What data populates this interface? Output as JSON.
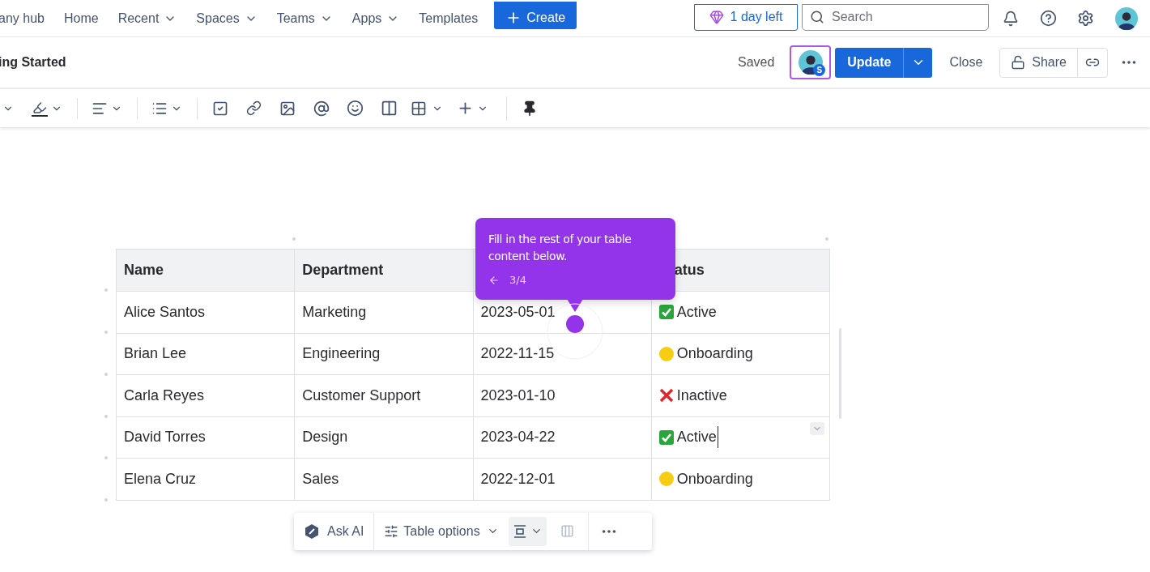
{
  "nav": {
    "items": [
      {
        "label": "any hub",
        "dropdown": false
      },
      {
        "label": "Home",
        "dropdown": false
      },
      {
        "label": "Recent",
        "dropdown": true
      },
      {
        "label": "Spaces",
        "dropdown": true
      },
      {
        "label": "Teams",
        "dropdown": true
      },
      {
        "label": "Apps",
        "dropdown": true
      },
      {
        "label": "Templates",
        "dropdown": false
      }
    ],
    "create": "Create",
    "trial": "1 day left",
    "search": {
      "placeholder": "Search"
    }
  },
  "page": {
    "title": "ing Started",
    "saved": "Saved",
    "collaborator_badge": "S",
    "update": "Update",
    "close": "Close",
    "share": "Share"
  },
  "tooltip": {
    "text": "Fill in the rest of your table content below.",
    "step": "3/4"
  },
  "table": {
    "columns": [
      {
        "label": "Name"
      },
      {
        "label": "Department"
      },
      {},
      {
        "label": "atus"
      }
    ],
    "rows": [
      {
        "name": "Alice Santos",
        "department": "Marketing",
        "date": "2023-05-01",
        "status": {
          "kind": "active",
          "label": "Active"
        },
        "editing": false
      },
      {
        "name": "Brian Lee",
        "department": "Engineering",
        "date": "2022-11-15",
        "status": {
          "kind": "onboarding",
          "label": "Onboarding"
        },
        "editing": false
      },
      {
        "name": "Carla Reyes",
        "department": "Customer Support",
        "date": "2023-01-10",
        "status": {
          "kind": "inactive",
          "label": "Inactive"
        },
        "editing": false
      },
      {
        "name": "David Torres",
        "department": "Design",
        "date": "2023-04-22",
        "status": {
          "kind": "active",
          "label": "Active"
        },
        "editing": true
      },
      {
        "name": "Elena Cruz",
        "department": "Sales",
        "date": "2022-12-01",
        "status": {
          "kind": "onboarding",
          "label": "Onboarding"
        },
        "editing": false
      }
    ]
  },
  "table_toolbar": {
    "ask_ai": "Ask AI",
    "table_options": "Table options"
  }
}
